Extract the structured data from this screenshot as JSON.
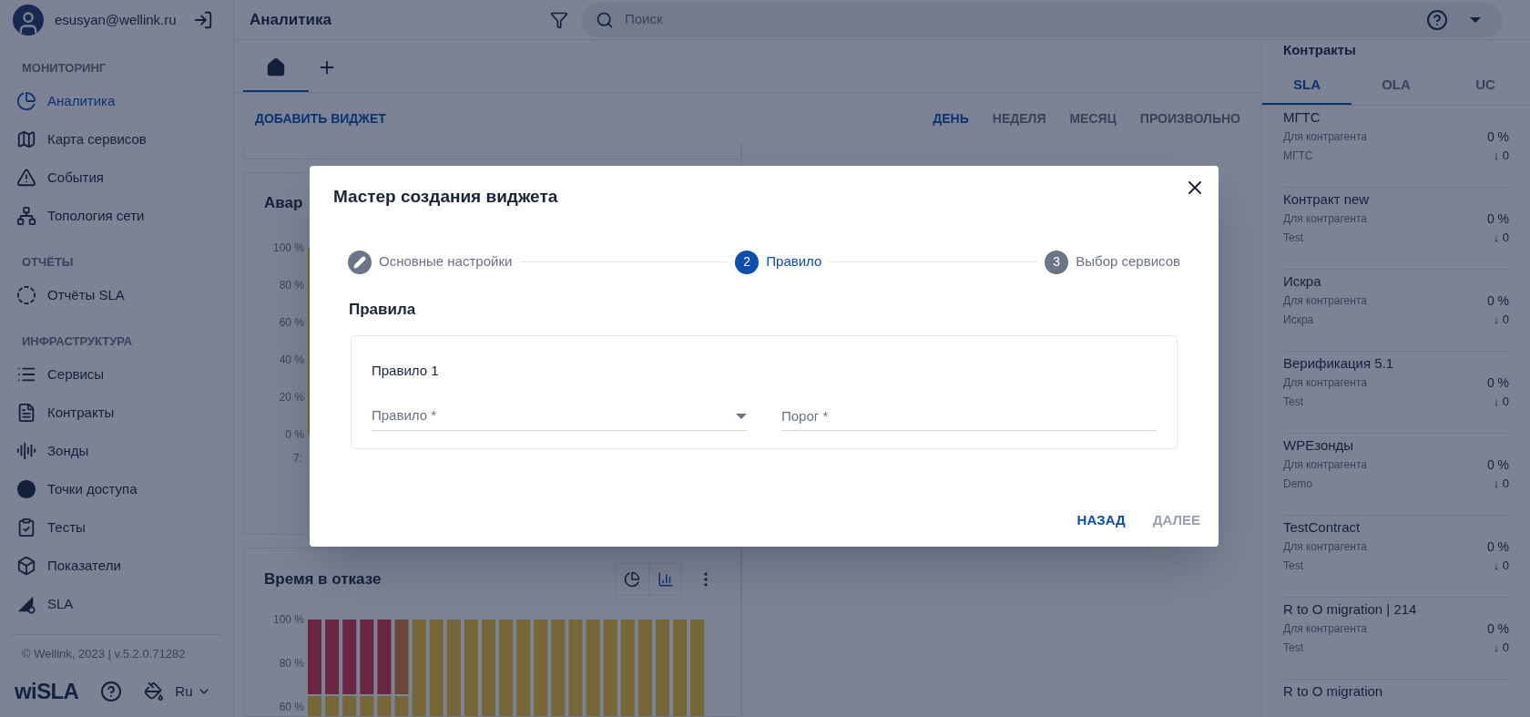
{
  "user": {
    "email": "esusyan@wellink.ru"
  },
  "sidebar": {
    "sections": [
      {
        "title": "МОНИТОРИНГ",
        "items": [
          {
            "kind": "pie",
            "label": "Аналитика",
            "selected": true
          },
          {
            "kind": "map",
            "label": "Карта сервисов",
            "selected": false
          },
          {
            "kind": "alert",
            "label": "События",
            "selected": false
          },
          {
            "kind": "topology",
            "label": "Топология сети",
            "selected": false
          }
        ]
      },
      {
        "title": "ОТЧЁТЫ",
        "items": [
          {
            "kind": "ring",
            "label": "Отчёты SLA",
            "selected": false
          }
        ]
      },
      {
        "title": "ИНФРАСТРУКТУРА",
        "items": [
          {
            "kind": "list",
            "label": "Сервисы",
            "selected": false
          },
          {
            "kind": "file",
            "label": "Контракты",
            "selected": false
          },
          {
            "kind": "wave",
            "label": "Зонды",
            "selected": false
          },
          {
            "kind": "dot",
            "label": "Точки доступа",
            "selected": false
          },
          {
            "kind": "clipboard",
            "label": "Тесты",
            "selected": false
          },
          {
            "kind": "cube",
            "label": "Показатели",
            "selected": false
          },
          {
            "kind": "sla",
            "label": "SLA",
            "selected": false
          }
        ]
      }
    ],
    "footer": "© Wellink, 2023 | v.5.2.0.71282",
    "logo": "wiSLA",
    "language": "Ru"
  },
  "topbar": {
    "title": "Аналитика",
    "search": {
      "placeholder": "Поиск"
    }
  },
  "tabs": [
    {
      "kind": "home",
      "selected": true
    },
    {
      "kind": "add",
      "selected": false
    }
  ],
  "toolbar": {
    "add_widget": "ДОБАВИТЬ ВИДЖЕТ",
    "periods": [
      {
        "label": "ДЕНЬ",
        "selected": true
      },
      {
        "label": "НЕДЕЛЯ",
        "selected": false
      },
      {
        "label": "МЕСЯЦ",
        "selected": false
      },
      {
        "label": "ПРОИЗВОЛЬНО",
        "selected": false
      }
    ]
  },
  "widgets": [
    {
      "title": "Авар",
      "yticks": [
        "100 %",
        "80 %",
        "60 %",
        "40 %",
        "20 %",
        "0 %"
      ],
      "xticks": [
        "7:"
      ]
    },
    {
      "title": "Время в отказе",
      "view_toggle": [
        {
          "kind": "pie",
          "selected": false
        },
        {
          "kind": "bar",
          "selected": true
        }
      ],
      "yticks": [
        "100 %",
        "80 %",
        "60 %"
      ]
    }
  ],
  "contracts": {
    "title": "Контракты",
    "tabs": [
      {
        "label": "SLA",
        "selected": true
      },
      {
        "label": "OLA",
        "selected": false
      },
      {
        "label": "UC",
        "selected": false
      }
    ],
    "items": [
      {
        "name": "МГТС",
        "type": "Для контрагента",
        "party": "МГТС",
        "percent": "0 %",
        "trend": "↓ 0"
      },
      {
        "name": "Контракт new",
        "type": "Для контрагента",
        "party": "Test",
        "percent": "0 %",
        "trend": "↓ 0"
      },
      {
        "name": "Искра",
        "type": "Для контрагента",
        "party": "Искра",
        "percent": "0 %",
        "trend": "↓ 0"
      },
      {
        "name": "Верификация 5.1",
        "type": "Для контрагента",
        "party": "Test",
        "percent": "0 %",
        "trend": "↓ 0"
      },
      {
        "name": "WPEзонды",
        "type": "Для контрагента",
        "party": "Demo",
        "percent": "0 %",
        "trend": "↓ 0"
      },
      {
        "name": "TestContract",
        "type": "Для контрагента",
        "party": "Test",
        "percent": "0 %",
        "trend": "↓ 0"
      },
      {
        "name": "R to O migration | 214",
        "type": "Для контрагента",
        "party": "Test",
        "percent": "0 %",
        "trend": "↓ 0"
      },
      {
        "name": "R to O migration"
      }
    ]
  },
  "dialog": {
    "title": "Мастер создания виджета",
    "steps": [
      {
        "label": "Основные настройки",
        "completed": true,
        "selected": false
      },
      {
        "number": "2",
        "label": "Правило",
        "completed": false,
        "selected": true
      },
      {
        "number": "3",
        "label": "Выбор сервисов",
        "completed": false,
        "selected": false
      }
    ],
    "section": "Правила",
    "rule": {
      "title": "Правило 1",
      "fields": [
        {
          "kind": "select",
          "placeholder": "Правило *"
        },
        {
          "kind": "text",
          "placeholder": "Порог *"
        }
      ]
    },
    "buttons": [
      {
        "label": "НАЗАД",
        "disabled": false
      },
      {
        "label": "ДАЛЕЕ",
        "disabled": true
      }
    ]
  }
}
